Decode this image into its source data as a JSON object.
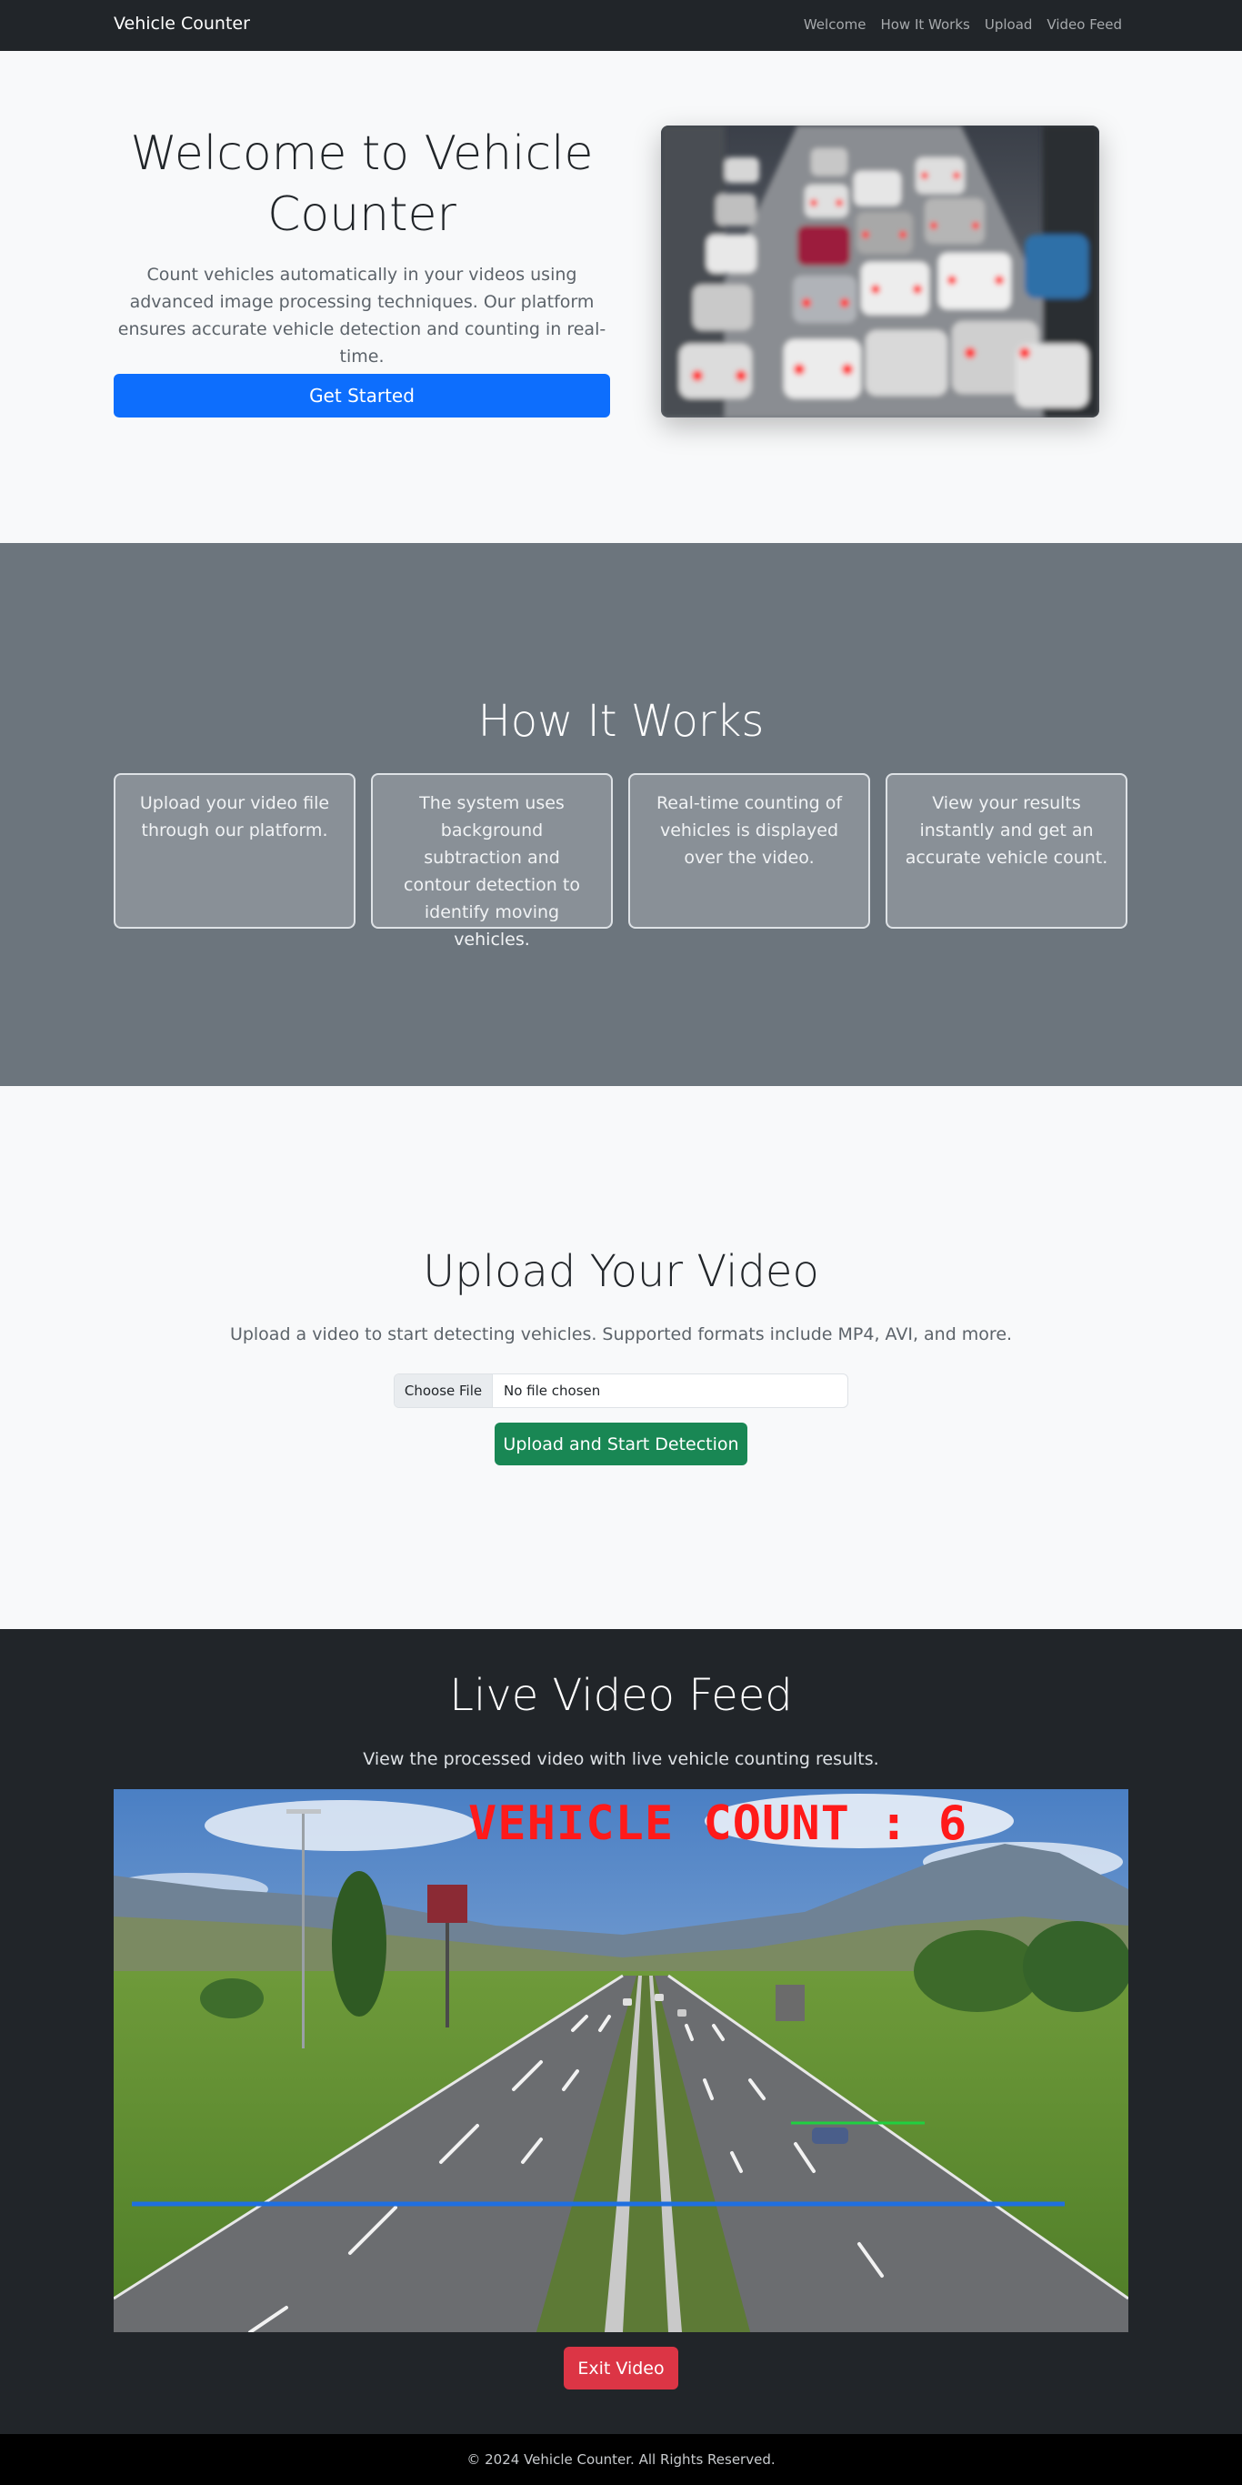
{
  "nav": {
    "brand": "Vehicle Counter",
    "links": [
      {
        "label": "Welcome"
      },
      {
        "label": "How It Works"
      },
      {
        "label": "Upload"
      },
      {
        "label": "Video Feed"
      }
    ]
  },
  "hero": {
    "title": "Welcome to Vehicle Counter",
    "text": "Count vehicles automatically in your videos using advanced image processing techniques. Our platform ensures accurate vehicle detection and counting in real-time.",
    "button": "Get Started"
  },
  "how": {
    "title": "How It Works",
    "steps": [
      {
        "text": "Upload your video file through our platform."
      },
      {
        "text": "The system uses background subtraction and contour detection to identify moving vehicles."
      },
      {
        "text": "Real-time counting of vehicles is displayed over the video."
      },
      {
        "text": "View your results instantly and get an accurate vehicle count."
      }
    ]
  },
  "upload": {
    "title": "Upload Your Video",
    "text": "Upload a video to start detecting vehicles. Supported formats include MP4, AVI, and more.",
    "file_button": "Choose File",
    "file_status": "No file chosen",
    "button": "Upload and Start Detection"
  },
  "feed": {
    "title": "Live Video Feed",
    "text": "View the processed video with live vehicle counting results.",
    "overlay_text": "VEHICLE COUNT : 6",
    "button": "Exit Video"
  },
  "footer": {
    "text": "© 2024 Vehicle Counter. All Rights Reserved."
  },
  "colors": {
    "primary": "#0d6efd",
    "success": "#198754",
    "danger": "#dc3545",
    "dark": "#212529",
    "secondary": "#6c757d"
  }
}
